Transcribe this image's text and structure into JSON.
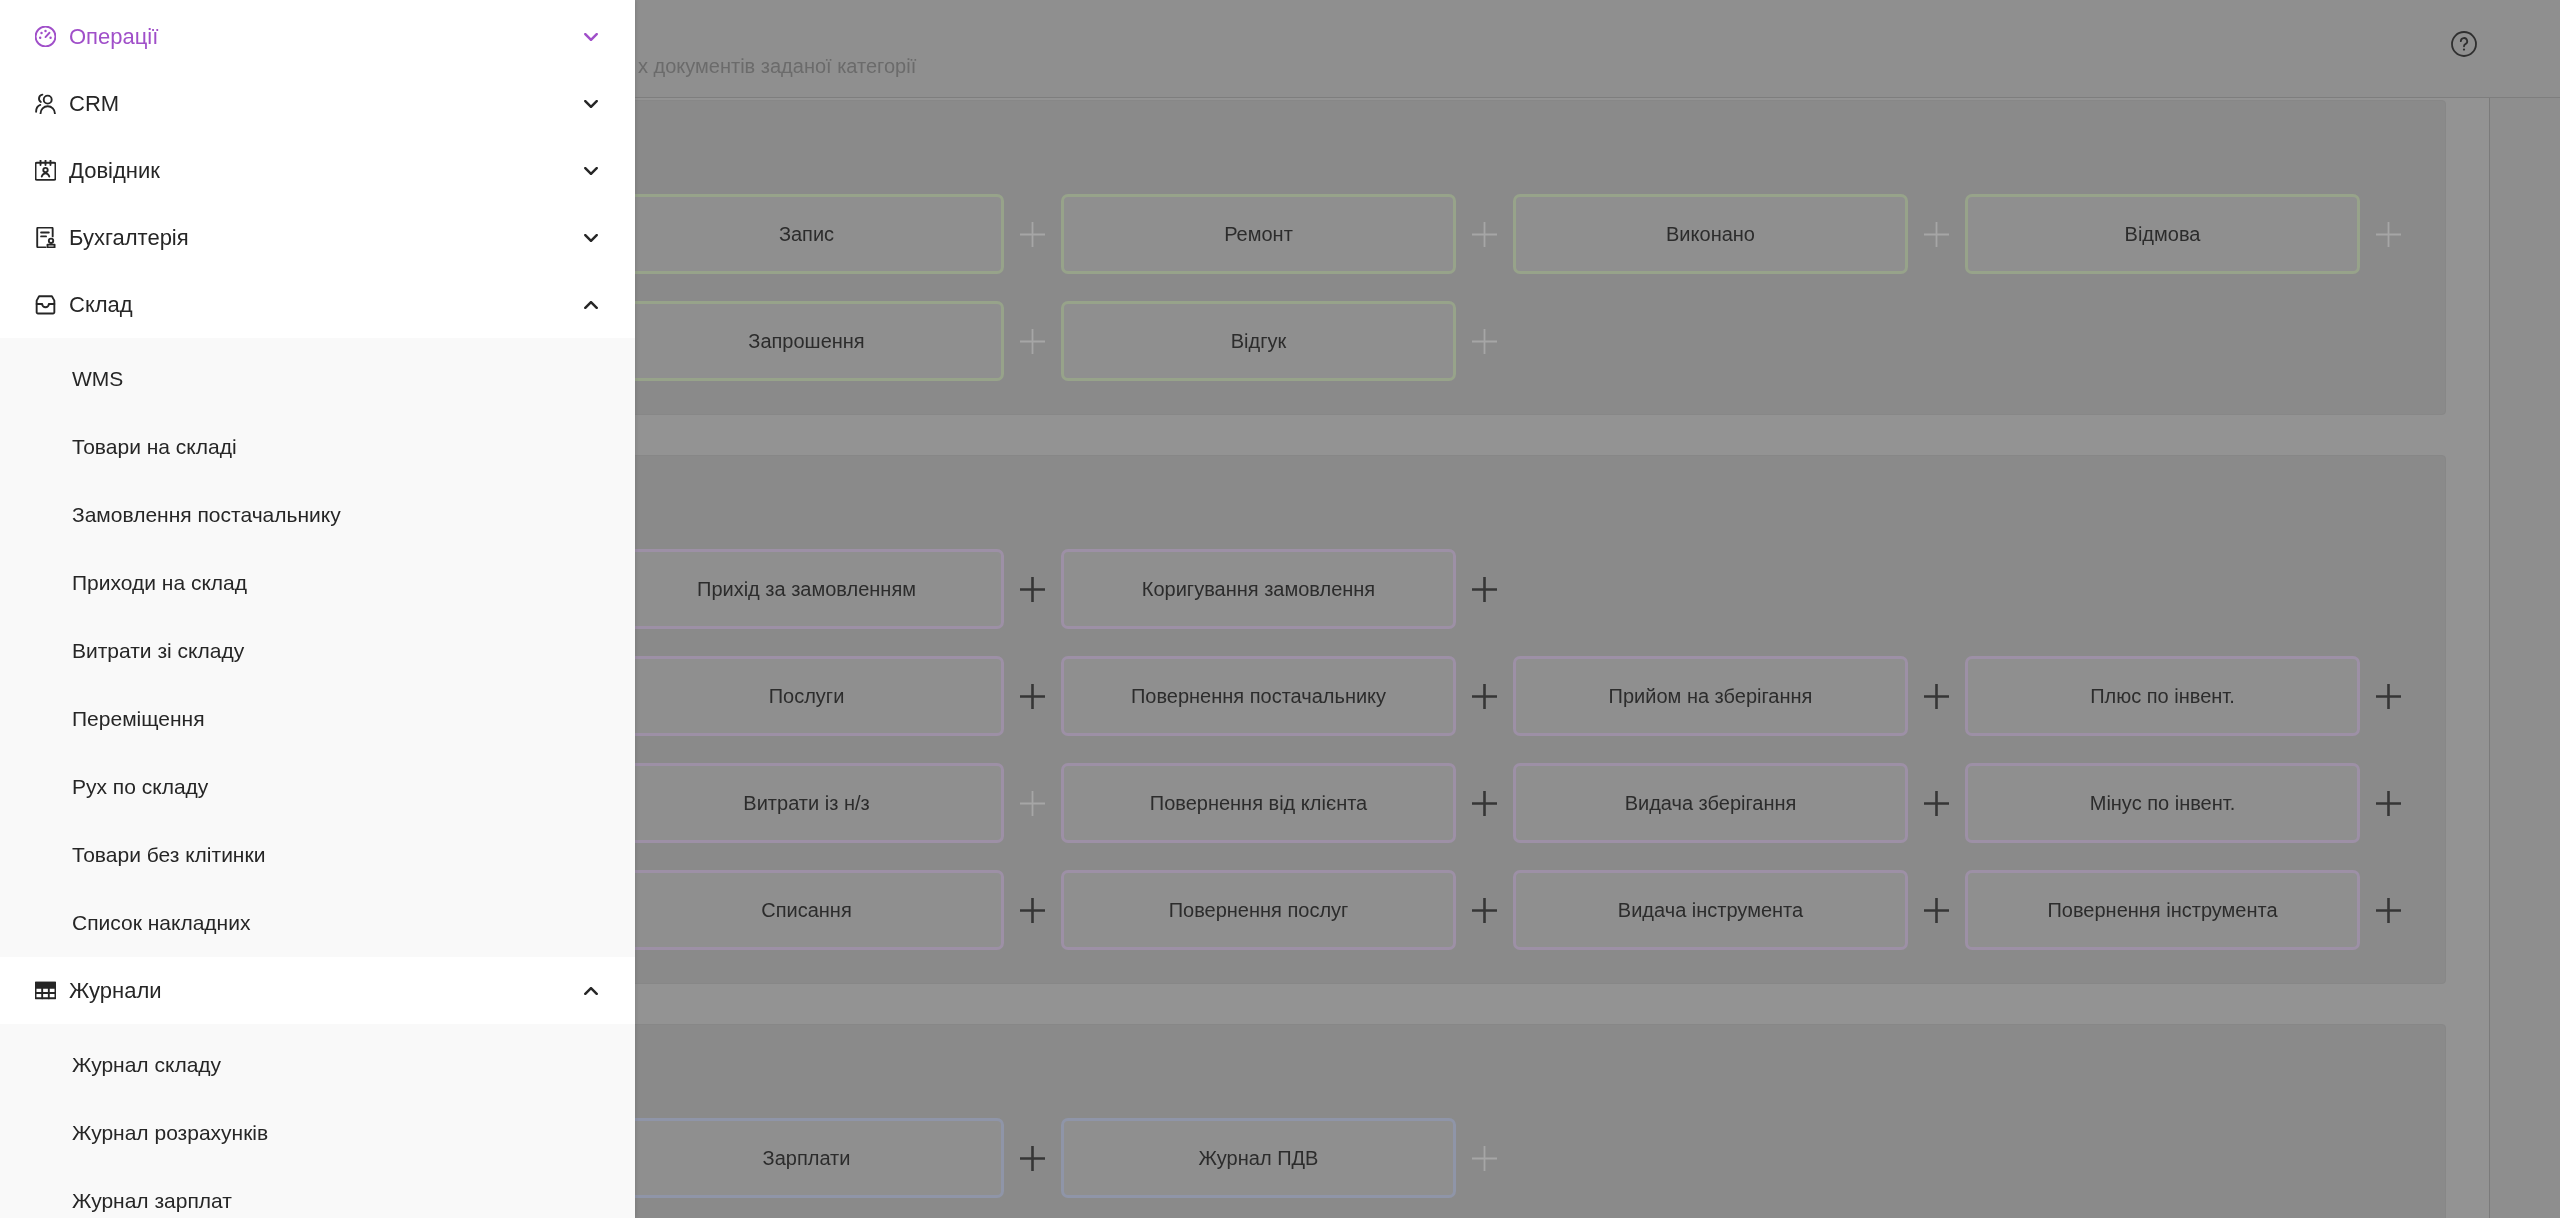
{
  "sidebar": {
    "items": [
      {
        "label": "Операції",
        "selected": true,
        "expanded": false
      },
      {
        "label": "CRM",
        "selected": false,
        "expanded": false
      },
      {
        "label": "Довідник",
        "selected": false,
        "expanded": false
      },
      {
        "label": "Бухгалтерія",
        "selected": false,
        "expanded": false
      },
      {
        "label": "Склад",
        "selected": false,
        "expanded": true,
        "children": [
          {
            "label": "WMS",
            "selected": false
          },
          {
            "label": "Товари на складі",
            "selected": false
          },
          {
            "label": "Замовлення постачальнику",
            "selected": false
          },
          {
            "label": "Приходи на склад",
            "selected": false
          },
          {
            "label": "Витрати зі складу",
            "selected": false
          },
          {
            "label": "Переміщення",
            "selected": false
          },
          {
            "label": "Рух по складу",
            "selected": false
          },
          {
            "label": "Товари без клітинки",
            "selected": false
          },
          {
            "label": "Список накладних",
            "selected": false
          }
        ]
      },
      {
        "label": "Журнали",
        "selected": false,
        "expanded": true,
        "children": [
          {
            "label": "Журнал складу",
            "selected": false
          },
          {
            "label": "Журнал розрахунків",
            "selected": false
          },
          {
            "label": "Журнал зарплат",
            "selected": false
          }
        ]
      }
    ]
  },
  "header": {
    "subtitle": "х документів заданої категорії"
  },
  "sections": [
    {
      "color": "#97a38a",
      "rows": [
        [
          {
            "label": "Запис",
            "add_disabled": true
          },
          {
            "label": "Ремонт",
            "add_disabled": true
          },
          {
            "label": "Виконано",
            "add_disabled": true
          },
          {
            "label": "Відмова",
            "add_disabled": true
          }
        ],
        [
          {
            "label": "Запрошення",
            "add_disabled": true
          },
          {
            "label": "Відгук",
            "add_disabled": true
          }
        ]
      ]
    },
    {
      "color": "#9d90a6",
      "rows": [
        [
          {
            "label": "Прихід за замовленням",
            "add_disabled": false
          },
          {
            "label": "Коригування замовлення",
            "add_disabled": false
          }
        ],
        [
          {
            "label": "Послуги",
            "add_disabled": false
          },
          {
            "label": "Повернення постачальнику",
            "add_disabled": false
          },
          {
            "label": "Прийом на зберігання",
            "add_disabled": false
          },
          {
            "label": "Плюс по інвент.",
            "add_disabled": false
          }
        ],
        [
          {
            "label": "Витрати із н/з",
            "add_disabled": true
          },
          {
            "label": "Повернення від клієнта",
            "add_disabled": false
          },
          {
            "label": "Видача зберігання",
            "add_disabled": false
          },
          {
            "label": "Мінус по інвент.",
            "add_disabled": false
          }
        ],
        [
          {
            "label": "Списання",
            "add_disabled": false
          },
          {
            "label": "Повернення послуг",
            "add_disabled": false
          },
          {
            "label": "Видача інструмента",
            "add_disabled": false
          },
          {
            "label": "Повернення інструмента",
            "add_disabled": false
          }
        ]
      ]
    },
    {
      "color": "#8f95a8",
      "rows": [
        [
          {
            "label": "Зарплати",
            "add_disabled": false
          },
          {
            "label": "Журнал ПДВ",
            "add_disabled": true
          }
        ]
      ]
    }
  ]
}
